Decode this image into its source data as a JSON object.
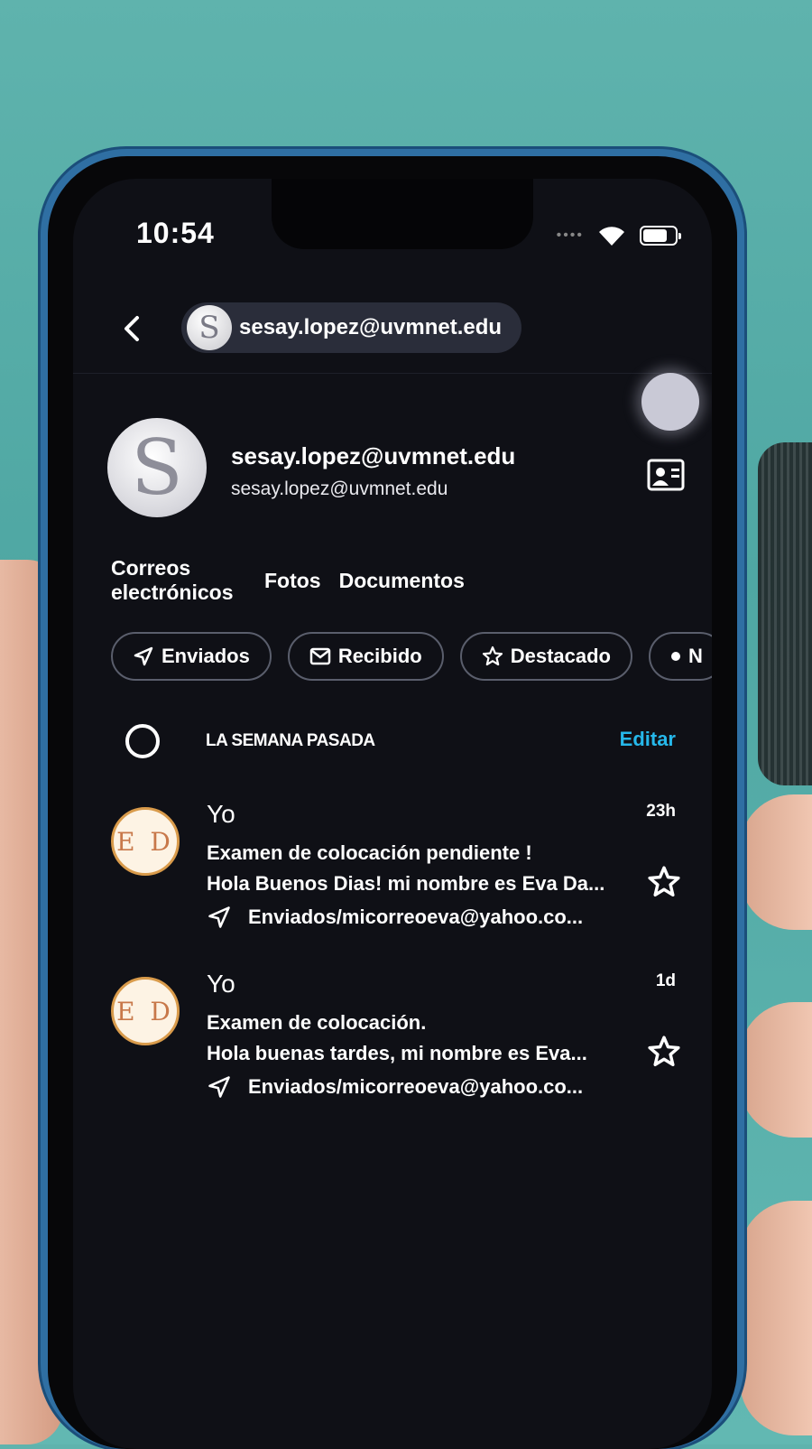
{
  "status_bar": {
    "time": "10:54",
    "battery_level": 0.8
  },
  "topbar": {
    "account_email": "sesay.lopez@uvmnet.edu",
    "chip_avatar_letter": "S"
  },
  "profile": {
    "avatar_letter": "S",
    "name": "sesay.lopez@uvmnet.edu",
    "email": "sesay.lopez@uvmnet.edu"
  },
  "tabs": [
    {
      "label_line1": "Correos",
      "label_line2": "electrónicos"
    },
    {
      "label": "Fotos"
    },
    {
      "label": "Documentos"
    }
  ],
  "filters": [
    {
      "label": "Enviados",
      "icon": "send-icon"
    },
    {
      "label": "Recibido",
      "icon": "envelope-icon"
    },
    {
      "label": "Destacado",
      "icon": "star-icon"
    },
    {
      "label": "N",
      "icon": "dot-icon"
    }
  ],
  "section": {
    "title": "LA SEMANA PASADA",
    "edit_label": "Editar"
  },
  "messages": [
    {
      "avatar_initials": "E D",
      "sender": "Yo",
      "time": "23h",
      "subject": "Examen de colocación pendiente !",
      "preview": "Hola Buenos Dias! mi nombre es Eva Da...",
      "folder": "Enviados/micorreoeva@yahoo.co..."
    },
    {
      "avatar_initials": "E D",
      "sender": "Yo",
      "time": "1d",
      "subject": "Examen de colocación.",
      "preview": "Hola buenas tardes, mi nombre es Eva...",
      "folder": "Enviados/micorreoeva@yahoo.co..."
    }
  ],
  "colors": {
    "accent": "#26b8ea",
    "background": "#0f1016",
    "chip_border": "#5a5e6c"
  }
}
